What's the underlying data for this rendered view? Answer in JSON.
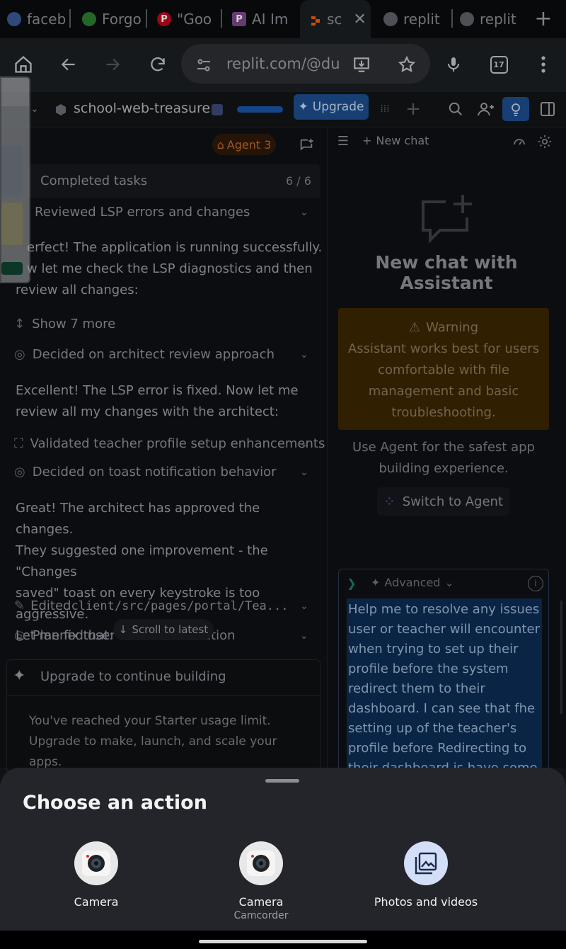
{
  "browser": {
    "tabs": [
      {
        "label": "faceb",
        "favicon_color": "#3b5998"
      },
      {
        "label": "Forgo",
        "favicon_color": "#2e7d32"
      },
      {
        "label": "\"Goo",
        "favicon_color": "#bd081c"
      },
      {
        "label": "AI Im",
        "favicon_color": "#7c4a8a"
      },
      {
        "label": "sc",
        "favicon_color": "#f26207"
      },
      {
        "label": "replit",
        "favicon_color": "#9aa0a6"
      },
      {
        "label": "replit",
        "favicon_color": "#9aa0a6"
      }
    ],
    "url": "replit.com/@du",
    "tab_count": "17"
  },
  "replit": {
    "project_name": "school-web-treasure",
    "upgrade_label": "Upgrade",
    "agent_badge": "Agent 3",
    "completed_tasks_label": "Completed tasks",
    "completed_tasks_count": "6 / 6",
    "feed": {
      "item1": "Reviewed LSP errors and changes",
      "para1_l1": "erfect! The application is running successfully.",
      "para1_l2": "w let me check the LSP diagnostics and then",
      "para1_l3": "review all changes:",
      "show_more": "Show 7 more",
      "item2": "Decided on architect review approach",
      "para2_l1": "Excellent! The LSP error is fixed. Now let me",
      "para2_l2": "review all my changes with the architect:",
      "item3": "Validated teacher profile setup enhancements",
      "item4": "Decided on toast notification behavior",
      "para3_l1": "Great! The architect has approved the changes.",
      "para3_l2": "They suggested one improvement - the \"Changes",
      "para3_l3": "saved\" toast on every keystroke is too aggressive.",
      "para3_l4": "Let me fix that:",
      "item5_prefix": "Edited ",
      "item5_path": "client/src/pages/portal/Tea...",
      "item6_a": "Planned user",
      "item6_b": "ation",
      "scroll_latest": "Scroll to latest"
    },
    "upgrade_card": {
      "title": "Upgrade to continue building",
      "line1": "You've reached your Starter usage limit.",
      "line2": "Upgrade to make, launch, and scale your",
      "line3": "apps."
    },
    "assistant": {
      "new_chat_label": "New chat",
      "heading": "New chat with Assistant",
      "warning_title": "Warning",
      "warning_l1": "Assistant works best for users",
      "warning_l2": "comfortable with file",
      "warning_l3": "management and basic",
      "warning_l4": "troubleshooting.",
      "note_l1": "Use Agent for the safest app",
      "note_l2": "building experience.",
      "switch_label": "Switch to Agent",
      "mode_label": "Advanced",
      "prompt": "Help me to resolve any issues user or teacher will encounter when trying to set up their profile before the system redirect them to their dashboard. I can see that fhe setting up of the teacher's profile before Redirecting to their dashboard is have some"
    }
  },
  "action_sheet": {
    "title": "Choose an action",
    "actions": [
      {
        "label": "Camera",
        "sublabel": ""
      },
      {
        "label": "Camera",
        "sublabel": "Camcorder"
      },
      {
        "label": "Photos and videos",
        "sublabel": ""
      }
    ]
  }
}
